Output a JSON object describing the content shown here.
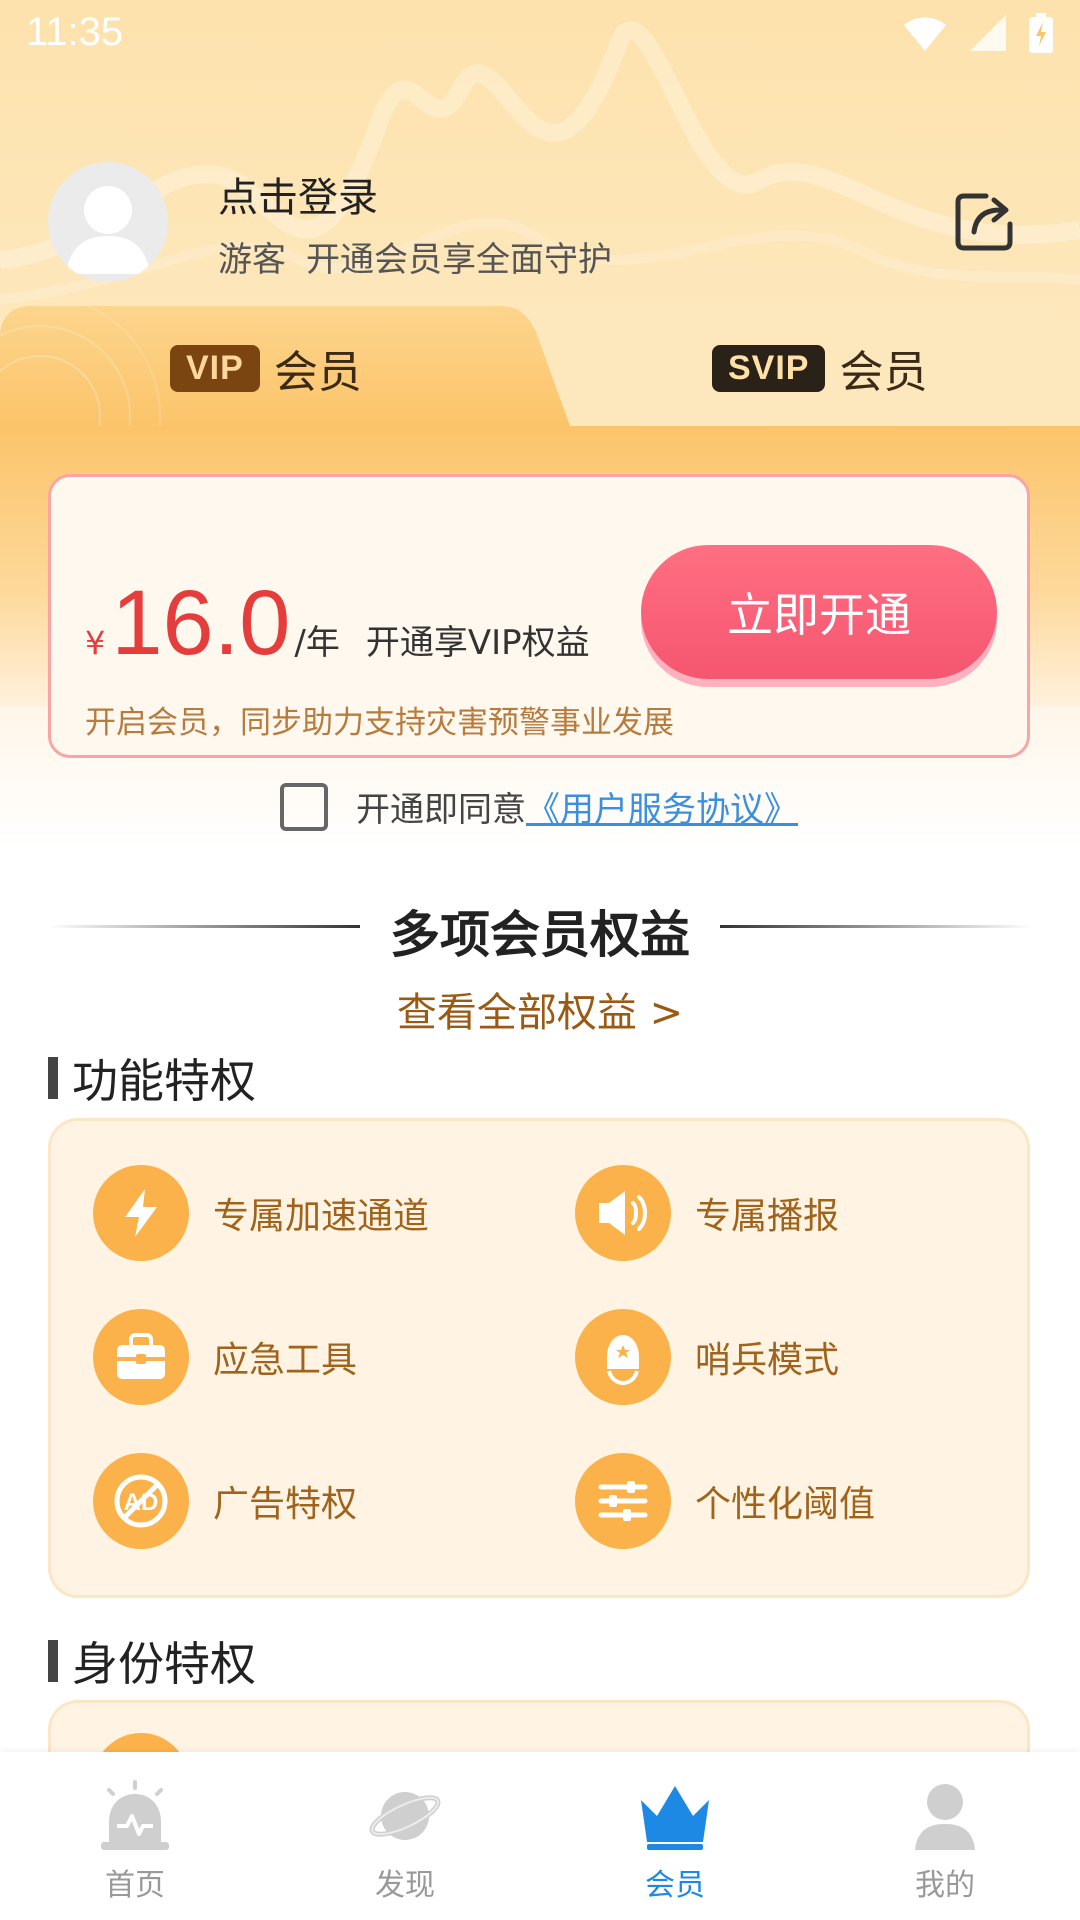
{
  "status_bar": {
    "time": "11:35"
  },
  "profile": {
    "login_title": "点击登录",
    "user_type": "游客",
    "user_tagline": "开通会员享全面守护"
  },
  "tabs": [
    {
      "badge": "VIP",
      "label": "会员",
      "active": true
    },
    {
      "badge": "SVIP",
      "label": "会员",
      "active": false
    }
  ],
  "price_card": {
    "currency": "¥",
    "price": "16.0",
    "unit": "/年",
    "description": "开通享VIP权益",
    "note": "开启会员，同步助力支持灾害预警事业发展",
    "button_label": "立即开通"
  },
  "agreement": {
    "text": "开通即同意",
    "link": "《用户服务协议》",
    "checked": false
  },
  "benefits": {
    "title": "多项会员权益",
    "view_all": "查看全部权益 >"
  },
  "feature_section": {
    "heading": "功能特权",
    "items": [
      {
        "label": "专属加速通道",
        "icon": "lightning-icon"
      },
      {
        "label": "专属播报",
        "icon": "speaker-icon"
      },
      {
        "label": "应急工具",
        "icon": "toolbox-icon"
      },
      {
        "label": "哨兵模式",
        "icon": "sentinel-icon"
      },
      {
        "label": "广告特权",
        "icon": "no-ad-icon"
      },
      {
        "label": "个性化阈值",
        "icon": "sliders-icon"
      }
    ]
  },
  "identity_section": {
    "heading": "身份特权"
  },
  "bottom_nav": [
    {
      "label": "首页",
      "icon": "alarm-icon"
    },
    {
      "label": "发现",
      "icon": "planet-icon"
    },
    {
      "label": "会员",
      "icon": "crown-icon",
      "active": true
    },
    {
      "label": "我的",
      "icon": "person-icon"
    }
  ],
  "colors": {
    "accent": "#f55670",
    "vip_brown": "#7a4510",
    "feature_orange": "#fbb24a",
    "nav_active": "#1e88e5"
  }
}
